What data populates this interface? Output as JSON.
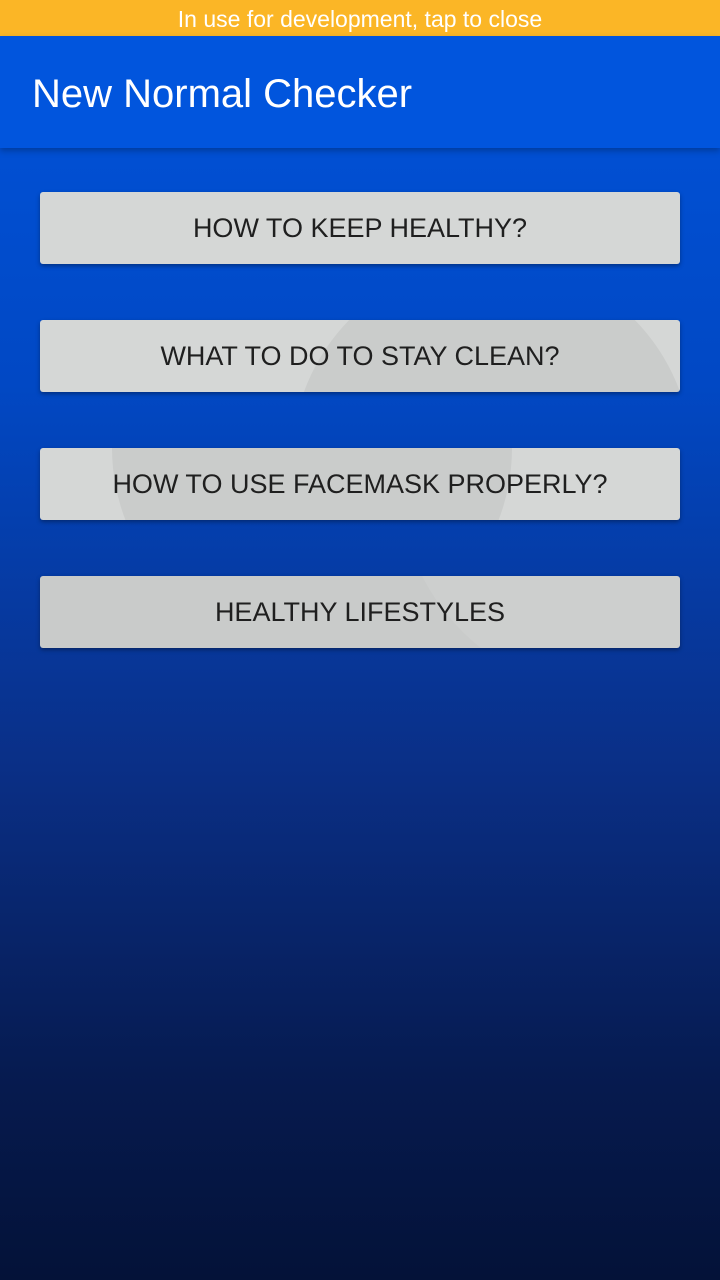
{
  "dev_banner": {
    "text": "In use for development, tap to close"
  },
  "app_bar": {
    "title": "New Normal Checker"
  },
  "menu": {
    "items": [
      {
        "label": "HOW TO KEEP HEALTHY?"
      },
      {
        "label": "WHAT TO DO TO STAY CLEAN?"
      },
      {
        "label": "HOW TO USE FACEMASK PROPERLY?"
      },
      {
        "label": "HEALTHY LIFESTYLES"
      }
    ]
  },
  "colors": {
    "banner": "#fbb626",
    "app_bar": "#0155dd",
    "button": "#d5d7d6",
    "button_text": "#1f1f1f",
    "background_top": "#0154dc",
    "background_bottom": "#041238"
  }
}
